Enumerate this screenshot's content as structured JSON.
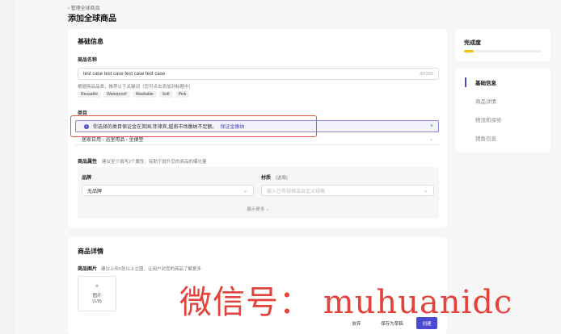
{
  "breadcrumb": "‹ 管理全球商品",
  "page_title": "添加全球商品",
  "basic": {
    "section_title": "基础信息",
    "name_label": "商品名称",
    "name_value": "test case test case test case test case",
    "name_counter": "43/255",
    "name_hint": "根据商品品类，推荐以下关键词（您可点击添加到标题中）",
    "keywords": [
      "Reusable",
      "Waterproof",
      "Washable",
      "Soft",
      "Pink"
    ],
    "category_label": "类目",
    "alert_text": "你选择的类目保证金在英国,菲律宾,越南市场缴纳不足额。",
    "alert_link": "保证金缴纳",
    "alert_close": "×",
    "category_value": "居家日用 - 浴室用品 - 坐便垫",
    "attr_label": "商品属性",
    "attr_hint": "建议至少填写2个属性，有助于提升您的商品的曝光量",
    "brand_label": "品牌",
    "brand_value": "无品牌",
    "material_label": "材质",
    "material_optional": "(选填)",
    "material_placeholder": "输入已有规格或自定义规格",
    "show_more": "展示更多 ⌄"
  },
  "detail": {
    "section_title": "商品详情",
    "images_label": "商品图片",
    "images_hint": "建议上传5张以上主图，让用户对您的商品了解更多",
    "upload_plus": "+",
    "upload_label": "图片",
    "upload_count": "(1/9)"
  },
  "side": {
    "completion_title": "完成度",
    "completion_fraction": 0.12,
    "nav": [
      "基础信息",
      "商品详情",
      "物流和保修",
      "销售信息"
    ],
    "active_index": 0
  },
  "footer": {
    "discard": "放弃",
    "save_draft": "保存为草稿",
    "create": "创建"
  },
  "watermark": "微信号：  muhuanidc",
  "colors": {
    "accent": "#4b4ad3",
    "warning_outline": "#e0534a",
    "progress": "#f5c400"
  }
}
